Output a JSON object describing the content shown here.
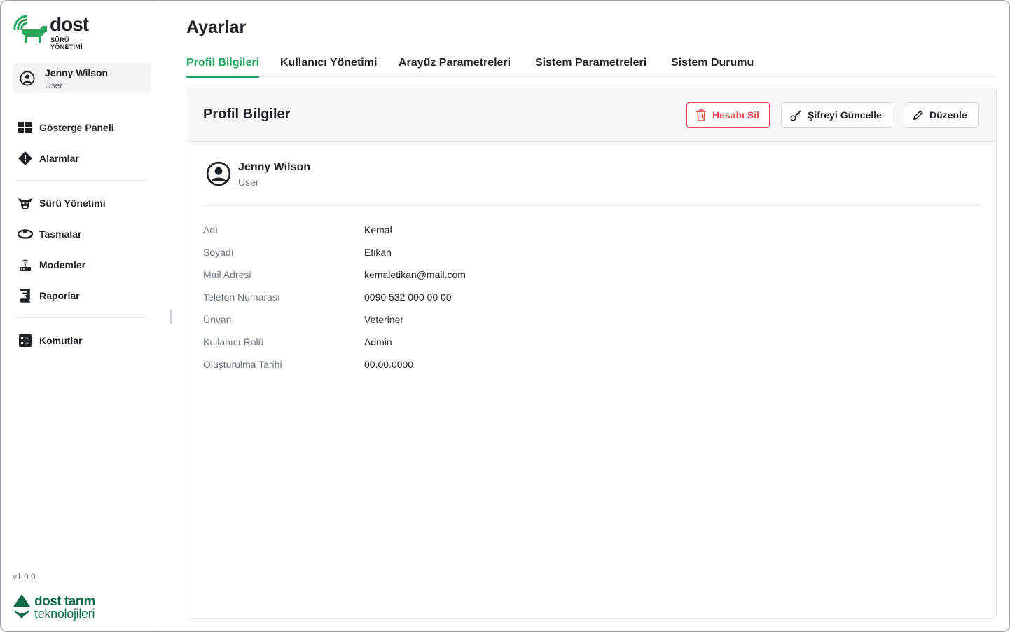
{
  "brand": {
    "name": "dost",
    "subtitle": "SÜRÜ YÖNETİMİ",
    "accent": "#28a55c",
    "dark_green": "#0f6b45"
  },
  "sidebar": {
    "user": {
      "name": "Jenny Wilson",
      "role": "User",
      "icon": "user-circle-icon"
    },
    "items": [
      {
        "label": "Gösterge Paneli",
        "icon": "dashboard-icon"
      },
      {
        "label": "Alarmlar",
        "icon": "alert-diamond-icon"
      },
      {
        "label": "Sürü Yönetimi",
        "icon": "cow-head-icon"
      },
      {
        "label": "Tasmalar",
        "icon": "collar-icon"
      },
      {
        "label": "Modemler",
        "icon": "router-icon"
      },
      {
        "label": "Raporlar",
        "icon": "report-book-icon"
      },
      {
        "label": "Komutlar",
        "icon": "command-list-icon"
      }
    ],
    "version": "v1.0.0",
    "footer_brand": {
      "line1": "dost tarım",
      "line2": "teknolojileri"
    }
  },
  "page": {
    "title": "Ayarlar"
  },
  "tabs": [
    {
      "label": "Profil Bilgileri",
      "active": true
    },
    {
      "label": "Kullanıcı Yönetimi",
      "active": false
    },
    {
      "label": "Arayüz Parametreleri",
      "active": false
    },
    {
      "label": "Sistem Parametreleri",
      "active": false
    },
    {
      "label": "Sistem Durumu",
      "active": false
    }
  ],
  "card": {
    "title": "Profil Bilgiler",
    "buttons": {
      "delete": "Hesabı Sil",
      "password": "Şifreyi Güncelle",
      "edit": "Düzenle"
    },
    "profile": {
      "name": "Jenny Wilson",
      "role": "User"
    },
    "fields": [
      {
        "label": "Adı",
        "value": "Kemal"
      },
      {
        "label": "Soyadı",
        "value": "Etikan"
      },
      {
        "label": "Mail Adresi",
        "value": "kemaletikan@mail.com"
      },
      {
        "label": "Telefon Numarası",
        "value": "0090 532 000 00 00"
      },
      {
        "label": "Ünvanı",
        "value": "Veteriner"
      },
      {
        "label": "Kullanıcı Rolü",
        "value": "Admin"
      },
      {
        "label": "Oluşturulma Tarihi",
        "value": "00.00.0000"
      }
    ]
  }
}
